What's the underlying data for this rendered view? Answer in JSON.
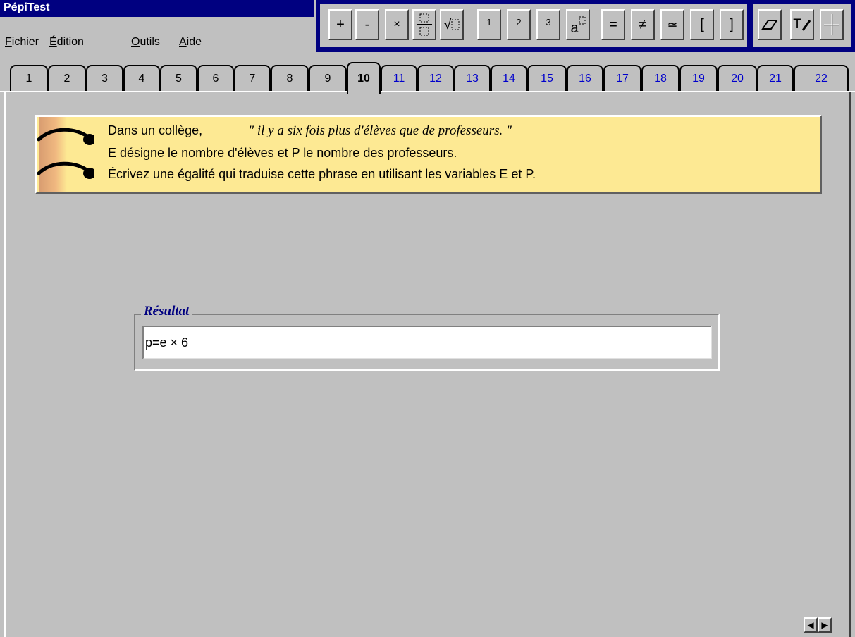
{
  "window": {
    "title": "PépiTest"
  },
  "menu": {
    "items": [
      {
        "label": "Fichier",
        "accel": "F",
        "rest": "ichier"
      },
      {
        "label": "Édition",
        "accel": "É",
        "rest": "dition"
      },
      {
        "label": "Outils",
        "accel": "O",
        "rest": "utils"
      },
      {
        "label": "Aide",
        "accel": "A",
        "rest": "ide"
      }
    ]
  },
  "toolbar": {
    "buttons": [
      {
        "name": "plus",
        "label": "+"
      },
      {
        "name": "minus",
        "label": "-"
      },
      {
        "name": "times",
        "label": "×"
      },
      {
        "name": "fraction",
        "label": ""
      },
      {
        "name": "sqrt",
        "label": "√"
      },
      {
        "name": "sup1",
        "label": "1"
      },
      {
        "name": "sup2",
        "label": "2"
      },
      {
        "name": "sup3",
        "label": "3"
      },
      {
        "name": "power",
        "label": "a"
      },
      {
        "name": "equals",
        "label": "="
      },
      {
        "name": "not-equal",
        "label": "≠"
      },
      {
        "name": "approx",
        "label": "≃"
      },
      {
        "name": "open-bracket",
        "label": "["
      },
      {
        "name": "close-bracket",
        "label": "]"
      }
    ],
    "tools": [
      {
        "name": "eraser-icon"
      },
      {
        "name": "text-edit-icon",
        "label": "T"
      },
      {
        "name": "crosshair-icon"
      }
    ]
  },
  "tabs": [
    "1",
    "2",
    "3",
    "4",
    "5",
    "6",
    "7",
    "8",
    "9",
    "10",
    "11",
    "12",
    "13",
    "14",
    "15",
    "16",
    "17",
    "18",
    "19",
    "20",
    "21",
    "22"
  ],
  "active_tab": "10",
  "question": {
    "line1_start": "Dans un collège,",
    "line1_quote": "\" il y a six fois plus d'élèves que de professeurs. \"",
    "line2": "E désigne le nombre d'élèves et P le nombre des professeurs.",
    "line3": "Écrivez une égalité qui traduise cette phrase en utilisant les variables E et P."
  },
  "result": {
    "legend": "Résultat",
    "value": "p=e × 6"
  },
  "nav": {
    "prev": "◀",
    "next": "▶"
  }
}
